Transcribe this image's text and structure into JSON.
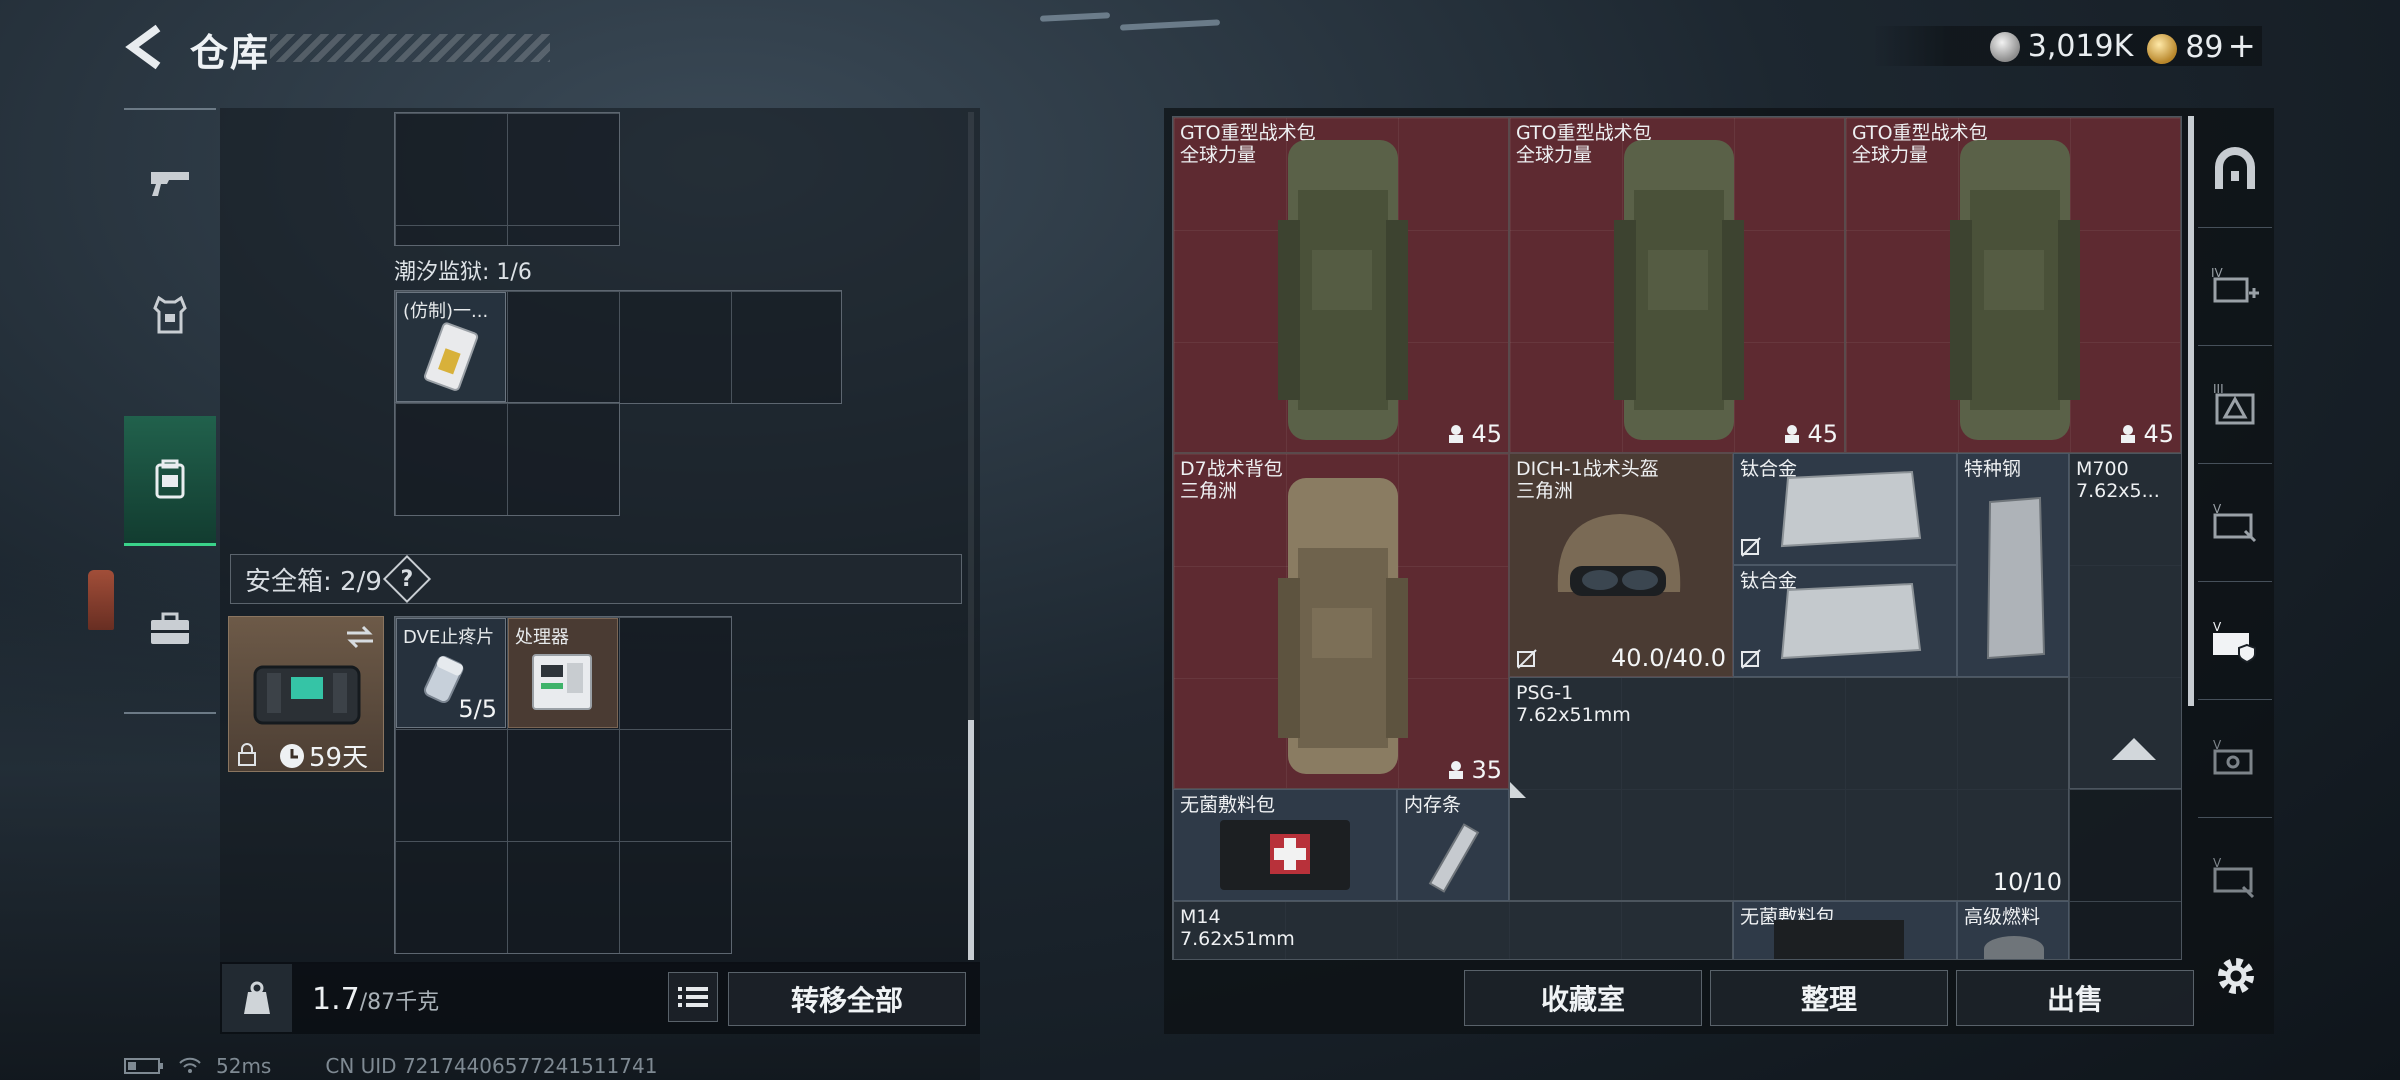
{
  "header": {
    "title": "仓库",
    "currency_silver": "3,019K",
    "currency_gold": "89",
    "currency_plus": "+"
  },
  "left_tabs": [
    "gun-icon",
    "armor-icon",
    "backpack-icon",
    "briefcase-icon"
  ],
  "backpack": {
    "tidal_prison_label": "潮汐监狱: 1/6",
    "tidal_item_name": "(仿制)一...",
    "safe_box_label": "安全箱: 2/9",
    "help_symbol": "?",
    "safe_box_duration": "59天",
    "safe_items": [
      {
        "name": "DVE止疼片",
        "qty": "5/5"
      },
      {
        "name": "处理器",
        "qty": ""
      }
    ],
    "weight_current": "1.7",
    "weight_max": "/87千克",
    "transfer_all_label": "转移全部"
  },
  "warehouse": {
    "items": [
      {
        "name": "GTO重型战术包",
        "sub": "全球力量",
        "qty": "45"
      },
      {
        "name": "GTO重型战术包",
        "sub": "全球力量",
        "qty": "45"
      },
      {
        "name": "GTO重型战术包",
        "sub": "全球力量",
        "qty": "45"
      },
      {
        "name": "D7战术背包",
        "sub": "三角洲",
        "qty": "35"
      },
      {
        "name": "DICH-1战术头盔",
        "sub": "三角洲",
        "qty": "40.0/40.0"
      },
      {
        "name": "钛合金",
        "sub": "",
        "qty": ""
      },
      {
        "name": "钛合金",
        "sub": "",
        "qty": ""
      },
      {
        "name": "特种钢",
        "sub": "",
        "qty": ""
      },
      {
        "name": "M700",
        "sub": "7.62x5...",
        "qty": ""
      },
      {
        "name": "PSG-1",
        "sub": "7.62x51mm",
        "qty": "10/10"
      },
      {
        "name": "无菌敷料包",
        "sub": "",
        "qty": ""
      },
      {
        "name": "内存条",
        "sub": "",
        "qty": ""
      },
      {
        "name": "M14",
        "sub": "7.62x51mm",
        "qty": ""
      },
      {
        "name": "无菌敷料包",
        "sub": "",
        "qty": ""
      },
      {
        "name": "高级燃料",
        "sub": "",
        "qty": ""
      }
    ],
    "buttons": {
      "collection": "收藏室",
      "organize": "整理",
      "sell": "出售"
    }
  },
  "status_bar": {
    "ping": "52ms",
    "uid": "CN UID 72174406577241511741"
  },
  "colors": {
    "accent_green": "#3ad38a",
    "item_red": "#5e2a31",
    "item_brown": "#4a3b33"
  }
}
